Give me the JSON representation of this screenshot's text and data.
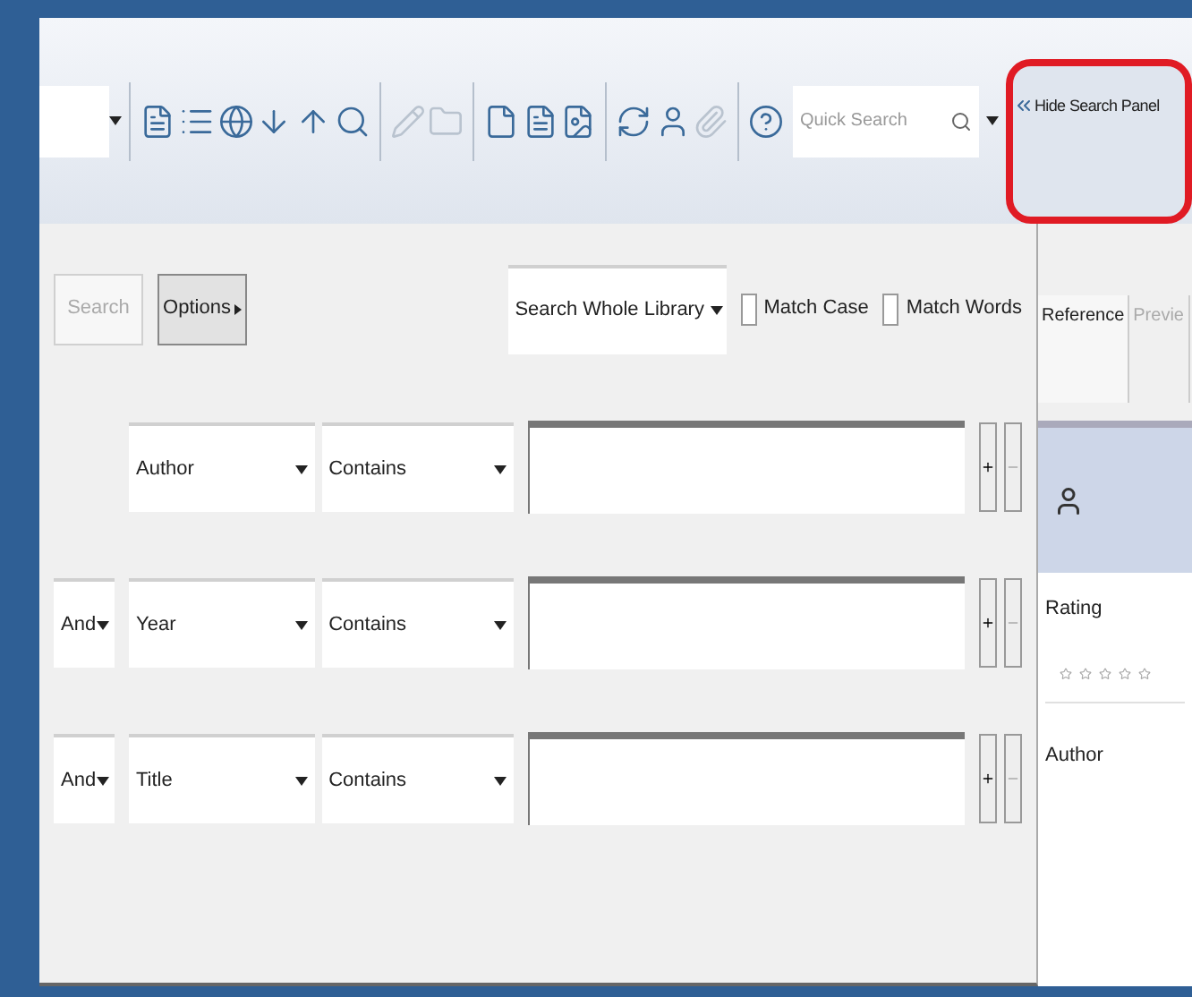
{
  "toolbar": {
    "quick_search": {
      "placeholder": "Quick Search"
    },
    "hide_button": "Hide Search Panel"
  },
  "search_bar": {
    "search_button": {
      "label": "Search",
      "disabled": true
    },
    "options_button": "Options",
    "scope": "Search Whole Library",
    "match_case": {
      "label": "Match Case",
      "checked": false
    },
    "match_words": {
      "label": "Match Words",
      "checked": false
    }
  },
  "criteria": [
    {
      "field": "Author",
      "condition": "Contains"
    },
    {
      "operator": "And",
      "field": "Year",
      "condition": "Contains"
    },
    {
      "operator": "And",
      "field": "Title",
      "condition": "Contains"
    }
  ],
  "reference_panel": {
    "tabs": [
      {
        "label": "Reference",
        "selected": true
      },
      {
        "label": "Previe",
        "selected": false
      }
    ],
    "fields": [
      {
        "label": "Rating",
        "kind": "rating",
        "stars": 0
      },
      {
        "label": "Author",
        "kind": "text"
      }
    ]
  }
}
